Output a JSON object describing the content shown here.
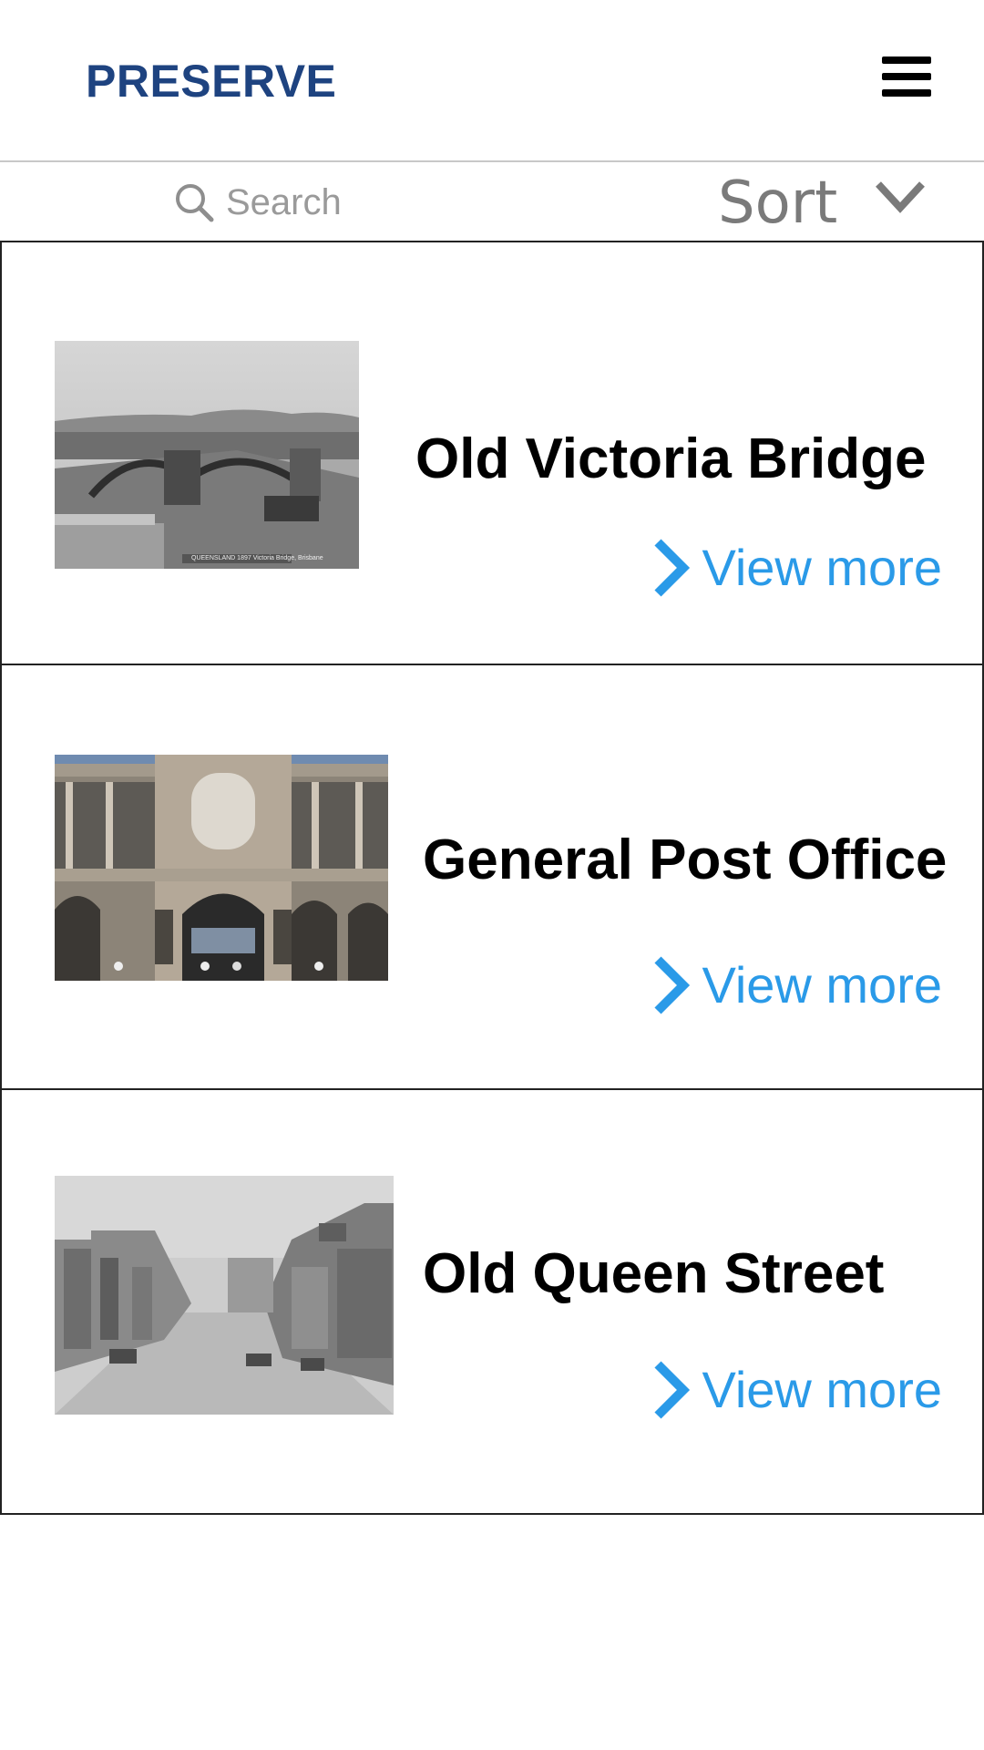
{
  "header": {
    "brand": "PRESERVE",
    "menu_icon": "hamburger-menu-icon"
  },
  "toolbar": {
    "search_placeholder": "Search",
    "search_icon": "search-icon",
    "sort_label": "Sort",
    "sort_icon": "chevron-down-icon"
  },
  "colors": {
    "brand": "#1e4380",
    "link": "#2a9ae8",
    "muted": "#8e8e8e"
  },
  "places": [
    {
      "title": "Old Victoria Bridge",
      "link_label": "View more",
      "image": "old-victoria-bridge-photo",
      "image_caption": "QUEENSLAND 1897 Victoria Bridge, Brisbane"
    },
    {
      "title": "General Post Office",
      "link_label": "View more",
      "image": "general-post-office-photo"
    },
    {
      "title": "Old Queen Street",
      "link_label": "View more",
      "image": "old-queen-street-photo"
    }
  ]
}
